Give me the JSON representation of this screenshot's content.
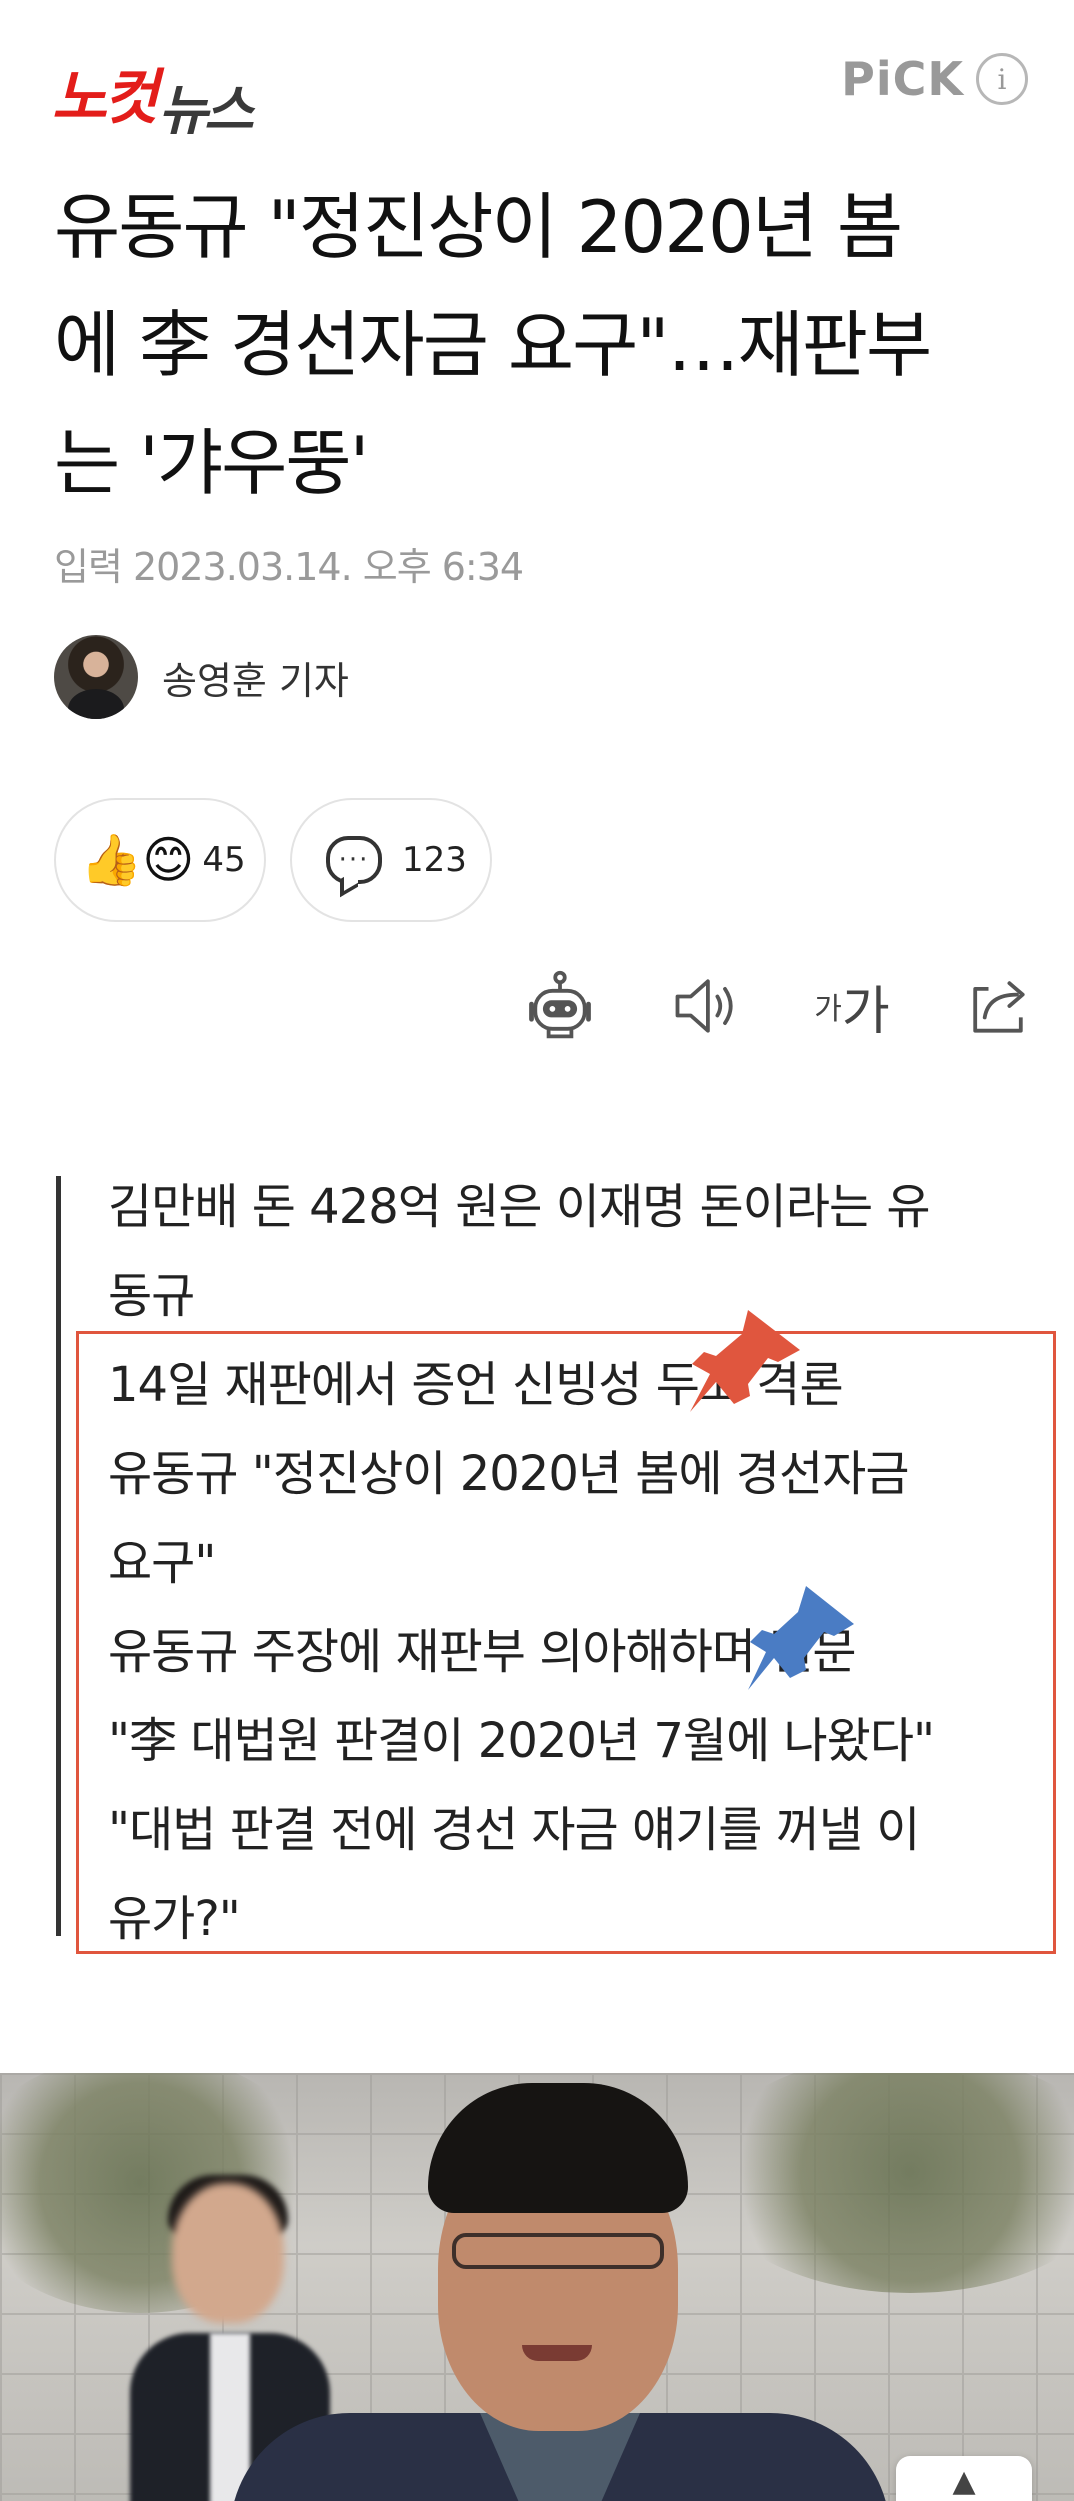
{
  "header": {
    "logo_part1": "노컷",
    "logo_part2": "뉴스",
    "pick_label": "PiCK",
    "info_icon_text": "i"
  },
  "article": {
    "headline_lines": [
      "유동규 \"정진상이 2020년 봄",
      "에 李 경선자금 요구\"…재판부",
      "는 '갸우뚱'"
    ],
    "published": "입력 2023.03.14. 오후 6:34",
    "author": "송영훈 기자"
  },
  "reactions": {
    "likes_emoji": "👍😊",
    "likes_count": "45",
    "comments_icon_text": "···",
    "comments_count": "123"
  },
  "tools": {
    "font_small": "가",
    "font_large": "가"
  },
  "summary": {
    "lines": [
      "김만배 돈 428억 원은 이재명 돈이라는 유",
      "동규",
      "14일 재판에서 증언 신빙성 두고 격론",
      "유동규 \"정진상이 2020년 봄에 경선자금",
      "요구\"",
      "유동규 주장에 재판부 의아해하며 질문",
      "\"李 대법원 판결이 2020년 7월에 나왔다\"",
      "\"대법 판결 전에 경선 자금 얘기를 꺼낼 이",
      "유가?\""
    ]
  },
  "scroll_top": {
    "arrow": "▲"
  },
  "colors": {
    "brand_red": "#e31d1a",
    "annotation_box": "#e0563e",
    "pin_red": "#e0563e",
    "pin_blue": "#4a7cc4"
  }
}
